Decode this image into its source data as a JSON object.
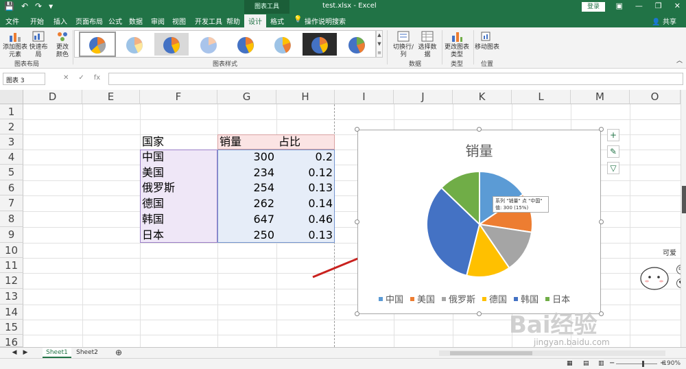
{
  "app": {
    "file_title": "test.xlsx - Excel",
    "context_tab": "图表工具",
    "login": "登录",
    "share": "共享"
  },
  "tabs": [
    "文件",
    "开始",
    "插入",
    "页面布局",
    "公式",
    "数据",
    "审阅",
    "视图",
    "开发工具",
    "帮助",
    "设计",
    "格式",
    "操作说明搜索"
  ],
  "ribbon": {
    "add_element": "添加图表元素",
    "quick_layout": "快速布局",
    "change_color": "更改颜色",
    "group_layout": "图表布局",
    "group_styles": "图表样式",
    "switch_row_col": "切换行/列",
    "select_data": "选择数据",
    "group_data": "数据",
    "change_type": "更改图表类型",
    "group_type": "类型",
    "move_chart": "移动图表",
    "group_location": "位置"
  },
  "formula_bar": {
    "name_box": "图表 3",
    "fx": "fx",
    "content": ""
  },
  "columns": [
    "D",
    "E",
    "F",
    "G",
    "H",
    "I",
    "J",
    "K",
    "L",
    "M",
    "O"
  ],
  "rows": [
    "1",
    "2",
    "3",
    "4",
    "5",
    "6",
    "7",
    "8",
    "9",
    "10",
    "11",
    "12",
    "13",
    "14",
    "15",
    "16"
  ],
  "table": {
    "headers": [
      "国家",
      "销量",
      "占比"
    ],
    "rows": [
      [
        "中国",
        "300",
        "0.2"
      ],
      [
        "美国",
        "234",
        "0.12"
      ],
      [
        "俄罗斯",
        "254",
        "0.13"
      ],
      [
        "德国",
        "262",
        "0.14"
      ],
      [
        "韩国",
        "647",
        "0.46"
      ],
      [
        "日本",
        "250",
        "0.13"
      ]
    ]
  },
  "chart_data": {
    "type": "pie",
    "title": "销量",
    "categories": [
      "中国",
      "美国",
      "俄罗斯",
      "德国",
      "韩国",
      "日本"
    ],
    "values": [
      300,
      234,
      254,
      262,
      647,
      250
    ],
    "colors": [
      "#5b9bd5",
      "#ed7d31",
      "#a5a5a5",
      "#ffc000",
      "#4472c4",
      "#70ad47"
    ],
    "legend": "bottom",
    "tooltip_line1": "系列 \"销量\" 点 \"中国\"",
    "tooltip_line2": "值: 300 (15%)"
  },
  "sheets": [
    "Sheet1",
    "Sheet2"
  ],
  "status": {
    "zoom": "190%"
  },
  "watermark": {
    "brand": "Bai经验",
    "url": "jingyan.baidu.com"
  },
  "decor": {
    "caption": "可爱"
  }
}
